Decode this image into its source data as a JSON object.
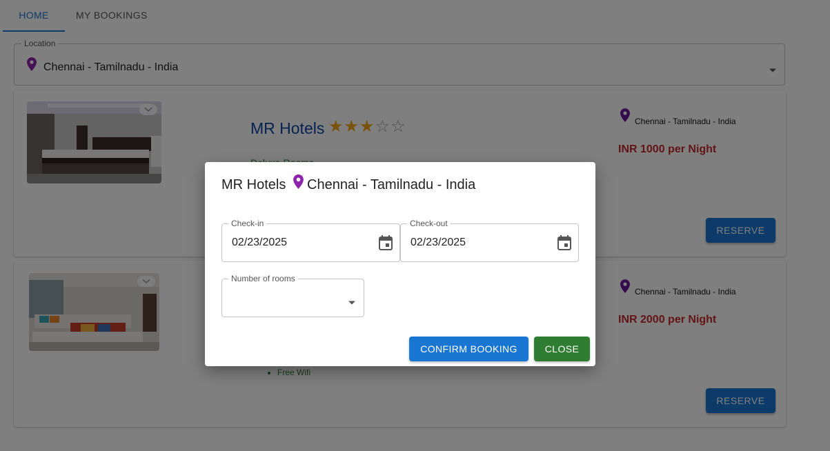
{
  "tabs": {
    "home": "HOME",
    "bookings": "MY BOOKINGS"
  },
  "location_select": {
    "label": "Location",
    "value": "Chennai - Tamilnadu - India"
  },
  "hotels": [
    {
      "name": "MR Hotels",
      "rating": 3,
      "rating_max": 5,
      "location": "Chennai - Tamilnadu - India",
      "price": "INR 1000 per Night",
      "reserve_label": "RESERVE",
      "partial_text": "Deluxe Rooms"
    },
    {
      "location": "Chennai - Tamilnadu - India",
      "price": "INR 2000 per Night",
      "amenity": "Free Wifi",
      "reserve_label": "RESERVE"
    }
  ],
  "dialog": {
    "hotel_name": "MR Hotels",
    "location": "Chennai - Tamilnadu - India",
    "checkin_label": "Check-in",
    "checkin_value": "02/23/2025",
    "checkout_label": "Check-out",
    "checkout_value": "02/23/2025",
    "rooms_label": "Number of rooms",
    "confirm_label": "CONFIRM BOOKING",
    "close_label": "CLOSE"
  },
  "colors": {
    "primary": "#1976d2",
    "hotel_name": "#0d47a1",
    "price": "#c62828",
    "close_button": "#2e7d32",
    "location_pin": "#8e24aa",
    "star": "#f3a712"
  },
  "icons": [
    "location-pin-icon",
    "dropdown-arrow-icon",
    "heart-icon",
    "star-icon",
    "calendar-icon"
  ]
}
